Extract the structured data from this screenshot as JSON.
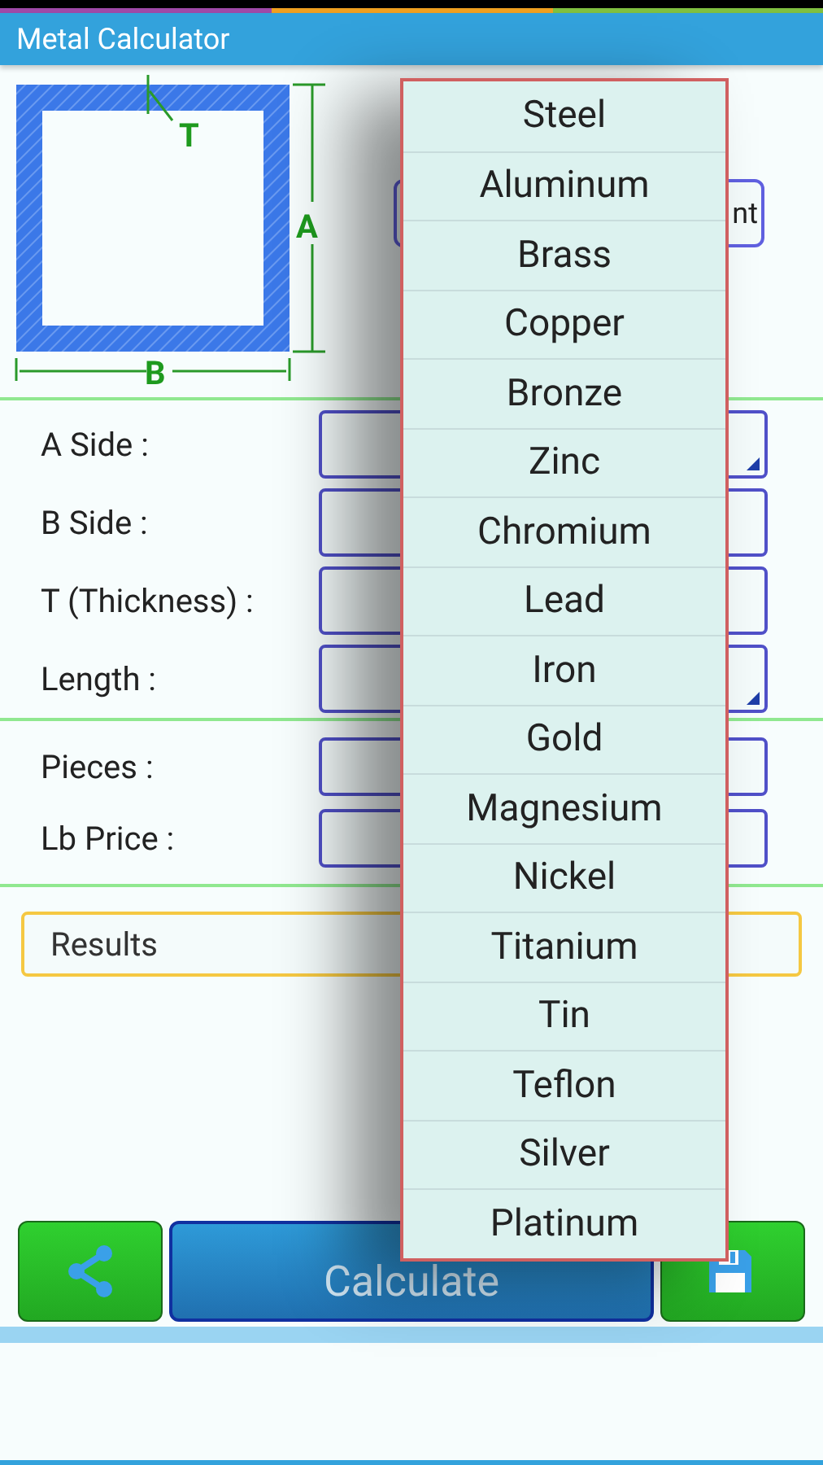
{
  "app_bar": {
    "title": "Metal Calculator"
  },
  "diagram": {
    "labels": [
      "T",
      "A",
      "B"
    ]
  },
  "unit_button": {
    "label": "nt"
  },
  "fields": [
    {
      "label": "A Side :",
      "spinner": true
    },
    {
      "label": "B Side :",
      "spinner": false
    },
    {
      "label": "T (Thickness) :",
      "spinner": false
    },
    {
      "label": "Length :",
      "spinner": true
    }
  ],
  "extra_fields": [
    {
      "label": "Pieces :"
    },
    {
      "label": "Lb Price :"
    }
  ],
  "results": {
    "label": "Results"
  },
  "calculate_button": {
    "label": "Calculate"
  },
  "metal_menu": {
    "items": [
      "Steel",
      "Aluminum",
      "Brass",
      "Copper",
      "Bronze",
      "Zinc",
      "Chromium",
      "Lead",
      "Iron",
      "Gold",
      "Magnesium",
      "Nickel",
      "Titanium",
      "Tin",
      "Teflon",
      "Silver",
      "Platinum"
    ]
  }
}
